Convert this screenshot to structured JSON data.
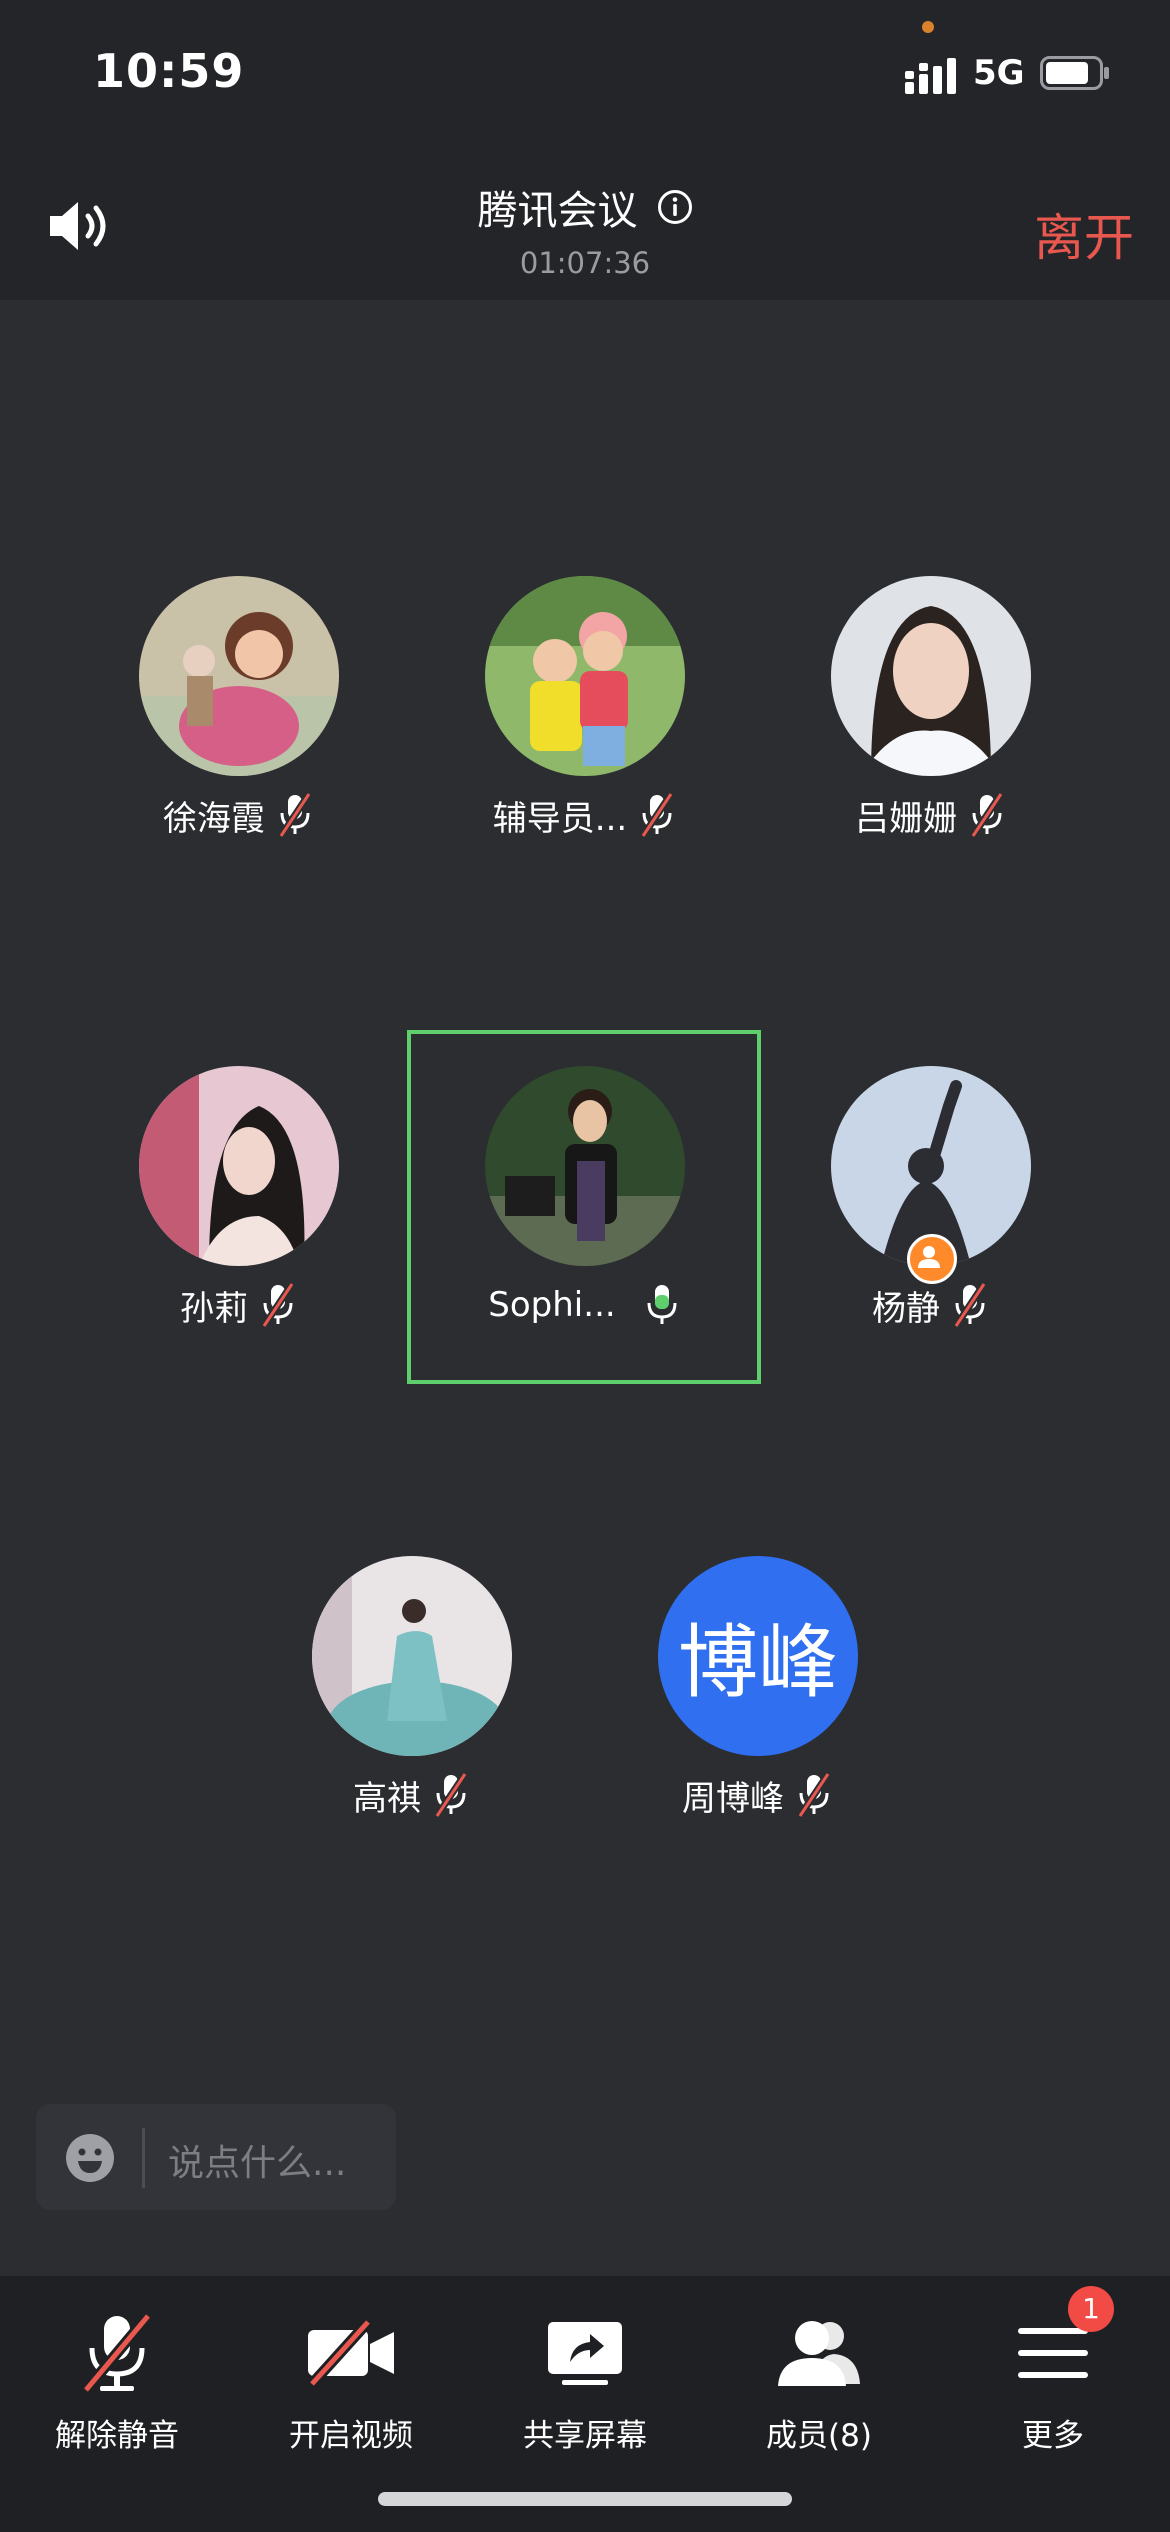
{
  "status_bar": {
    "time": "10:59",
    "network": "5G"
  },
  "header": {
    "title": "腾讯会议",
    "duration": "01:07:36",
    "leave_label": "离开"
  },
  "participants": [
    {
      "name": "徐海霞",
      "mic": "muted"
    },
    {
      "name": "辅导员...",
      "mic": "muted"
    },
    {
      "name": "吕姗姗",
      "mic": "muted"
    },
    {
      "name": "孙莉",
      "mic": "muted"
    },
    {
      "name": "Sophi...",
      "mic": "on",
      "speaking": true
    },
    {
      "name": "杨静",
      "mic": "muted",
      "host": true
    },
    {
      "name": "高祺",
      "mic": "muted"
    },
    {
      "name": "周博峰",
      "mic": "muted",
      "avatar_text": "博峰"
    }
  ],
  "chat": {
    "placeholder": "说点什么..."
  },
  "toolbar": {
    "unmute": "解除静音",
    "video": "开启视频",
    "share": "共享屏幕",
    "members": "成员(8)",
    "more": "更多",
    "more_badge": "1"
  },
  "colors": {
    "leave": "#e8584f",
    "speaking_border": "#5ecf6c",
    "mic_on": "#5ecf6c",
    "badge": "#f24a45",
    "initials_bg": "#2f6ff0"
  }
}
